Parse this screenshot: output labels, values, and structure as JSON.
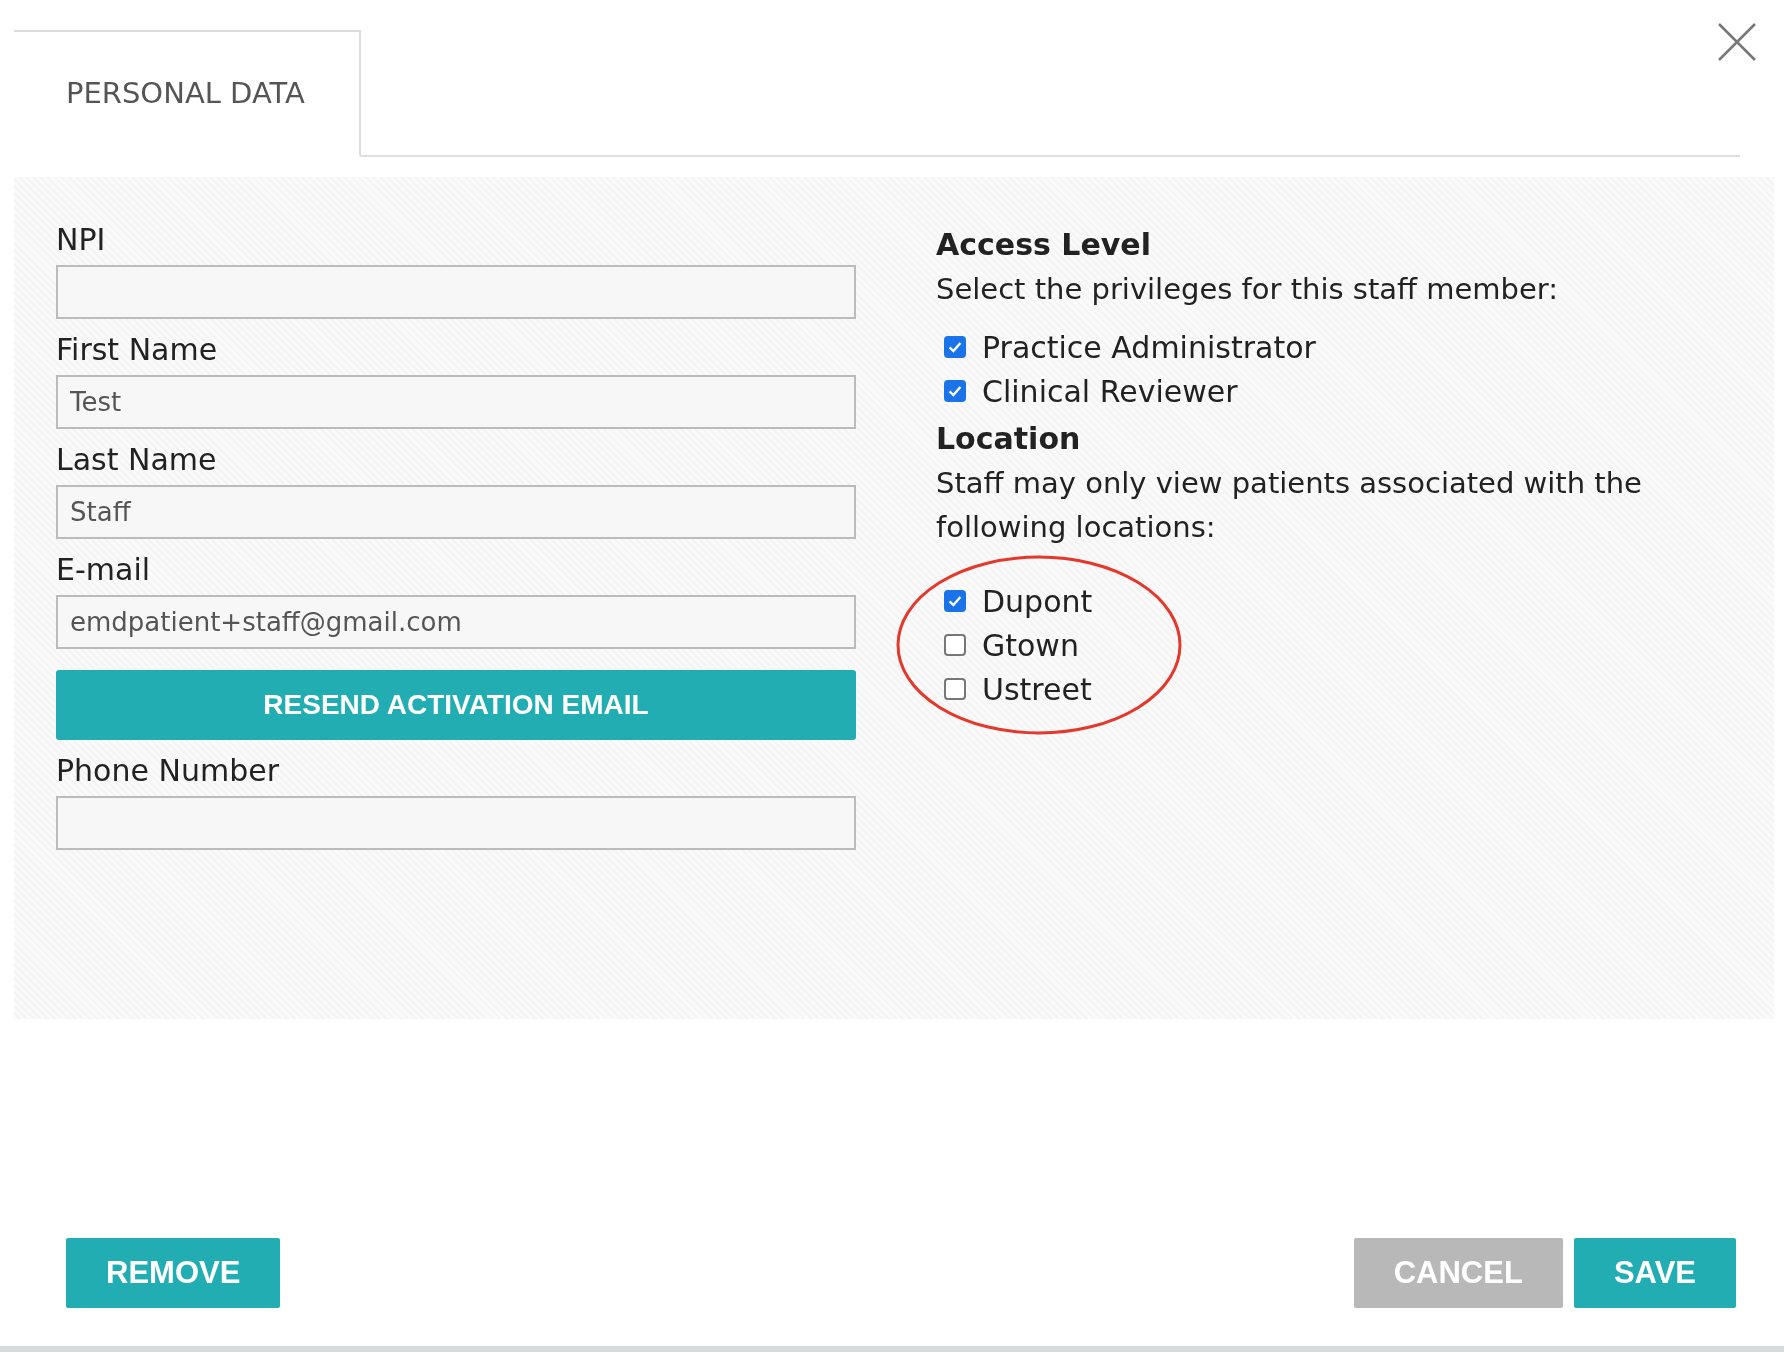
{
  "tabs": [
    {
      "label": "PERSONAL DATA",
      "selected": true
    }
  ],
  "left_column": [
    {
      "kind": "field",
      "label": "NPI"
    },
    {
      "kind": "field",
      "label": "First Name",
      "value": "Test"
    },
    {
      "kind": "field",
      "label": "Last Name",
      "value": "Staff"
    },
    {
      "kind": "field",
      "label": "E-mail",
      "value": "emdpatient+staff@gmail.com"
    },
    {
      "kind": "button",
      "label": "RESEND ACTIVATION EMAIL"
    },
    {
      "kind": "field",
      "label": "Phone Number"
    }
  ],
  "access_level": {
    "title": "Access Level",
    "description": "Select the privileges for this staff member:",
    "options": [
      {
        "label": "Practice Administrator",
        "checked": true
      },
      {
        "label": "Clinical Reviewer",
        "checked": true
      }
    ]
  },
  "location": {
    "title": "Location",
    "description": "Staff may only view patients associated with the following locations:",
    "highlighted": true,
    "options": [
      {
        "label": "Dupont",
        "checked": true
      },
      {
        "label": "Gtown",
        "checked": false
      },
      {
        "label": "Ustreet",
        "checked": false
      }
    ]
  },
  "footer": {
    "left": [
      {
        "label": "REMOVE",
        "kind": "primary"
      }
    ],
    "right": [
      {
        "label": "CANCEL",
        "kind": "secondary"
      },
      {
        "label": "SAVE",
        "kind": "primary"
      }
    ]
  }
}
